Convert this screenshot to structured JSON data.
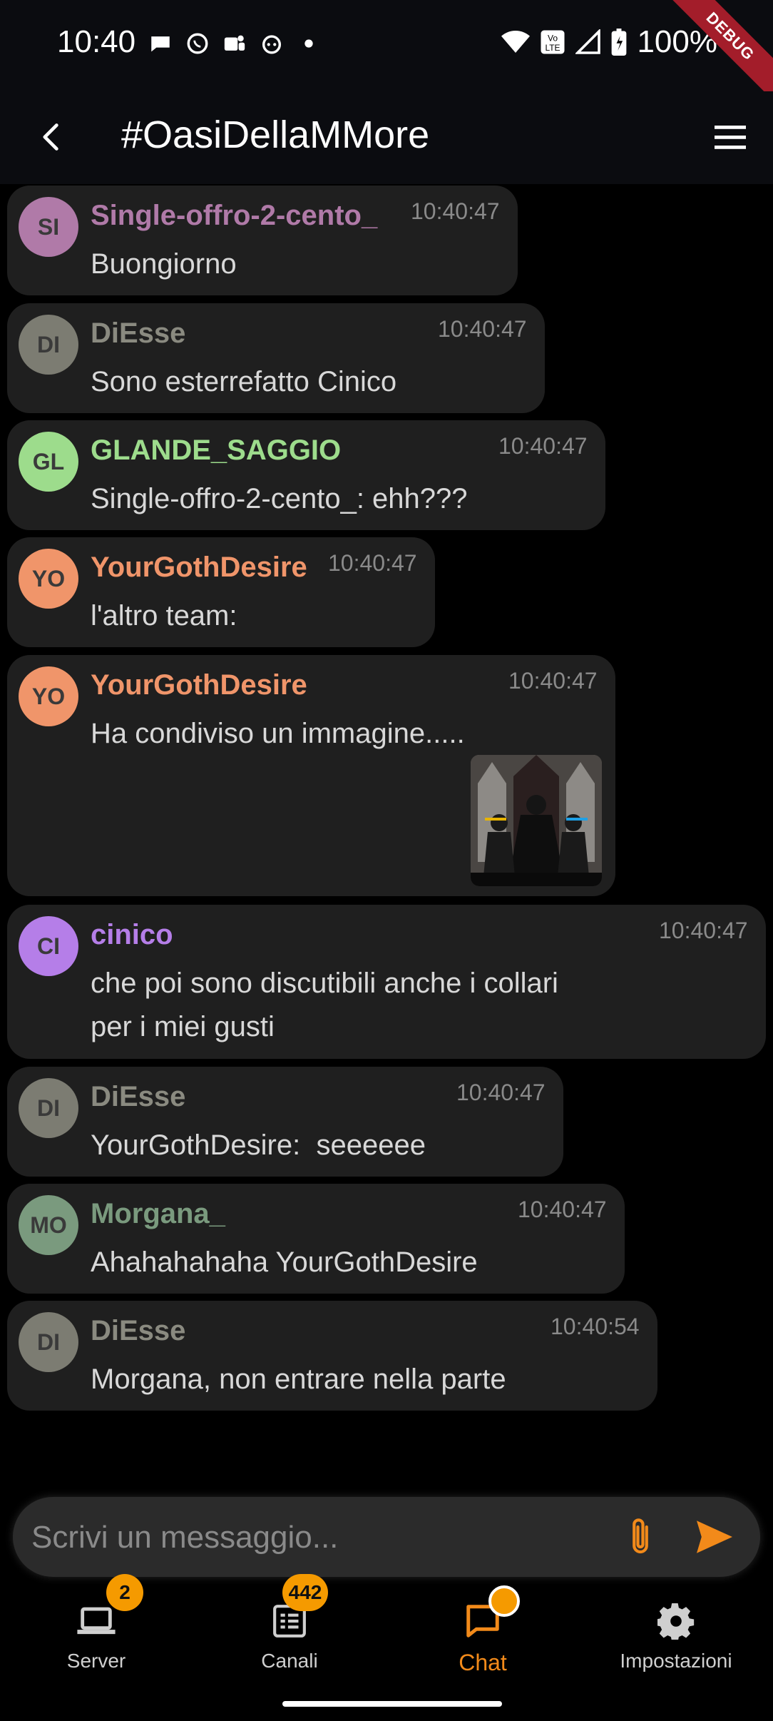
{
  "status_bar": {
    "time": "10:40",
    "battery": "100%",
    "debug_label": "DEBUG",
    "left_icons": [
      "chat-bubble-icon",
      "whatsapp-icon",
      "teams-icon",
      "reddit-icon",
      "dot-icon"
    ],
    "right_icons": [
      "wifi-icon",
      "volte-icon",
      "signal-icon",
      "battery-icon"
    ]
  },
  "app_bar": {
    "title": "#OasiDellaMMore",
    "back_icon": "back-arrow-icon",
    "menu_icon": "hamburger-menu-icon"
  },
  "messages": [
    {
      "initials": "SI",
      "sender": "Single-offro-2-cento_",
      "time": "10:40:47",
      "text": "Buongiorno",
      "avatar_color": "#b07aa8",
      "name_color": "#b07aa8"
    },
    {
      "initials": "DI",
      "sender": "DiEsse",
      "time": "10:40:47",
      "text": "Sono esterrefatto Cinico",
      "avatar_color": "#7c7c72",
      "name_color": "#8a8a80"
    },
    {
      "initials": "GL",
      "sender": "GLANDE_SAGGIO",
      "time": "10:40:47",
      "text": "Single-offro-2-cento_: ehh???",
      "avatar_color": "#9ddc8c",
      "name_color": "#9ddc8c"
    },
    {
      "initials": "YO",
      "sender": "YourGothDesire",
      "time": "10:40:47",
      "text": "l'altro team:",
      "avatar_color": "#f0956a",
      "name_color": "#f0956a"
    },
    {
      "initials": "YO",
      "sender": "YourGothDesire",
      "time": "10:40:47",
      "text": "Ha condiviso un immagine.....",
      "avatar_color": "#f0956a",
      "name_color": "#f0956a",
      "has_image": true
    },
    {
      "initials": "CI",
      "sender": "cinico",
      "time": "10:40:47",
      "text_lines": [
        "che poi sono discutibili anche i collari",
        "per i miei gusti"
      ],
      "avatar_color": "#b57ee8",
      "name_color": "#b57ee8"
    },
    {
      "initials": "DI",
      "sender": "DiEsse",
      "time": "10:40:47",
      "text": "YourGothDesire:  seeeeee",
      "avatar_color": "#7c7c72",
      "name_color": "#8a8a80"
    },
    {
      "initials": "MO",
      "sender": "Morgana_",
      "time": "10:40:47",
      "text": "Ahahahahaha YourGothDesire",
      "avatar_color": "#7a9a7e",
      "name_color": "#7a9a7e"
    },
    {
      "initials": "DI",
      "sender": "DiEsse",
      "time": "10:40:54",
      "text": "Morgana, non entrare nella parte",
      "avatar_color": "#7c7c72",
      "name_color": "#8a8a80"
    }
  ],
  "composer": {
    "placeholder": "Scrivi un messaggio...",
    "attach_icon": "paperclip-icon",
    "send_icon": "send-icon",
    "accent": "#f28a1a"
  },
  "bottom_nav": {
    "items": [
      {
        "label": "Server",
        "icon": "laptop-icon",
        "badge": "2"
      },
      {
        "label": "Canali",
        "icon": "list-icon",
        "badge": "442"
      },
      {
        "label": "Chat",
        "icon": "chat-icon",
        "active": true
      },
      {
        "label": "Impostazioni",
        "icon": "gear-icon"
      }
    ]
  }
}
